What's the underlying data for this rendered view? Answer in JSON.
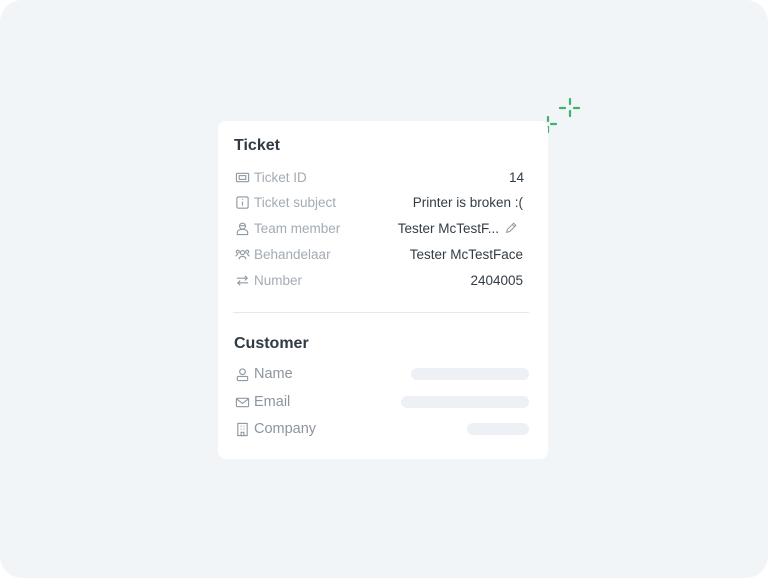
{
  "ticket": {
    "title": "Ticket",
    "fields": [
      {
        "label": "Ticket ID",
        "value": "14",
        "icon": "ticket-icon"
      },
      {
        "label": "Ticket subject",
        "value": "Printer is broken :(",
        "icon": "info-icon"
      },
      {
        "label": "Team member",
        "value": "Tester McTestF...",
        "icon": "agent-icon",
        "editable": true
      },
      {
        "label": "Behandelaar",
        "value": "Tester McTestFace",
        "icon": "group-icon"
      },
      {
        "label": "Number",
        "value": "2404005",
        "icon": "arrows-icon"
      }
    ]
  },
  "customer": {
    "title": "Customer",
    "fields": [
      {
        "label": "Name",
        "icon": "person-icon",
        "loading": true
      },
      {
        "label": "Email",
        "icon": "mail-icon",
        "loading": true
      },
      {
        "label": "Company",
        "icon": "building-icon",
        "loading": true
      }
    ]
  },
  "colors": {
    "background": "#f1f5f8",
    "card": "#ffffff",
    "accent": "#3fb26b",
    "skeleton": "#edf1f5"
  }
}
